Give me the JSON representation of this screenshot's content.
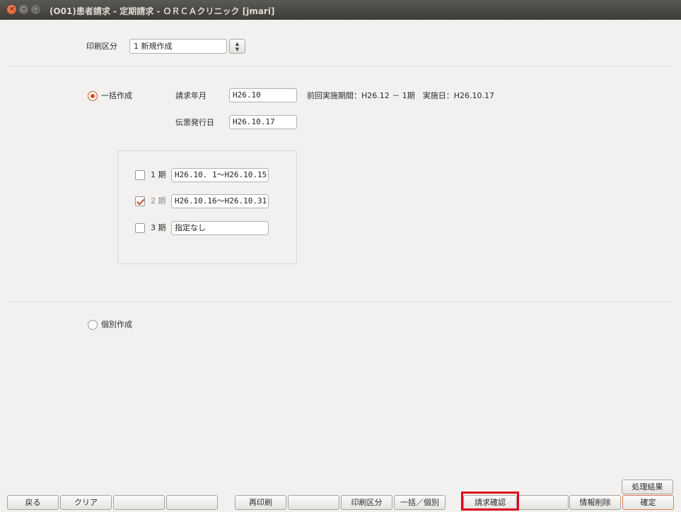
{
  "window": {
    "title": "(O01)患者請求 - 定期請求 - ＯＲＣＡクリニック [jmari]"
  },
  "print_section": {
    "label": "印刷区分",
    "value": "1 新規作成"
  },
  "bulk": {
    "radio_label": "一括作成",
    "selected": true,
    "billing_month_label": "請求年月",
    "billing_month_value": "H26.10",
    "previous_info": "前回実施期間：H26.12 － 1期　実施日：H26.10.17",
    "slip_date_label": "伝票発行日",
    "slip_date_value": "H26.10.17"
  },
  "periods": [
    {
      "label": "1 期",
      "checked": false,
      "value": "H26.10. 1～H26.10.15"
    },
    {
      "label": "2 期",
      "checked": true,
      "value": "H26.10.16～H26.10.31"
    },
    {
      "label": "3 期",
      "checked": false,
      "value": "指定なし"
    }
  ],
  "individual": {
    "radio_label": "個別作成",
    "selected": false
  },
  "buttons": {
    "back": "戻る",
    "clear": "クリア",
    "blank1": "",
    "blank2": "",
    "reprint": "再印刷",
    "blank3": "",
    "print_section": "印刷区分",
    "bulk_individual": "一括／個別",
    "billing_confirm": "請求確認",
    "blank4": "",
    "delete_info": "情報削除",
    "confirm": "確定",
    "process_result": "処理結果"
  },
  "colors": {
    "accent": "#df4a16",
    "highlight_box": "#e0001c",
    "title_bar": "#3c3b37"
  }
}
